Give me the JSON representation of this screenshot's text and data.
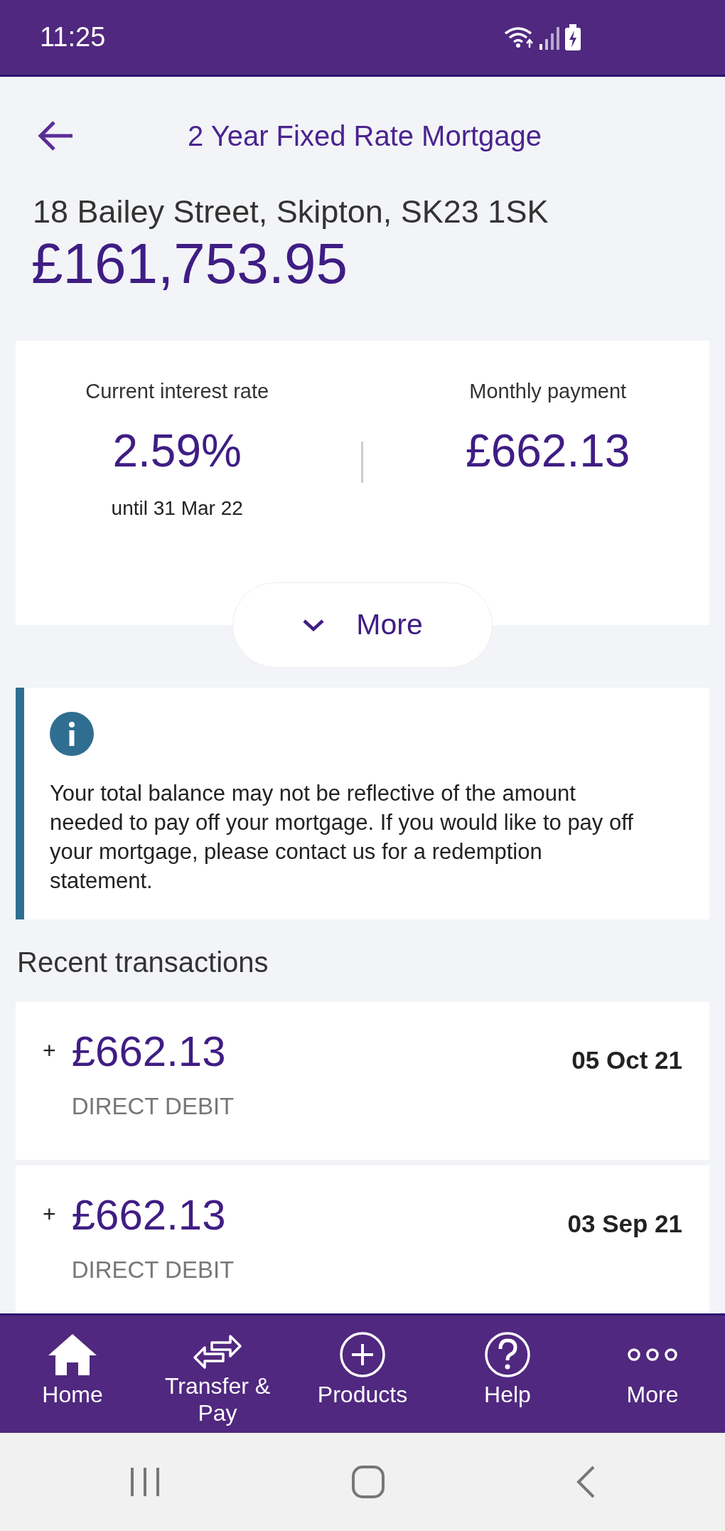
{
  "status_bar": {
    "time": "11:25"
  },
  "header": {
    "title": "2 Year Fixed Rate Mortgage"
  },
  "account": {
    "address": "18 Bailey Street, Skipton, SK23 1SK",
    "balance": "£161,753.95"
  },
  "summary": [
    {
      "label": "Current interest rate",
      "value": "2.59%",
      "note": "until 31 Mar 22"
    },
    {
      "label": "Monthly payment",
      "value": "£662.13"
    }
  ],
  "more_button": {
    "label": "More",
    "expanded": false
  },
  "info": {
    "text": "Your total balance may not be reflective of the amount needed to pay off your mortgage. If you would like to pay off your mortgage, please contact us for a redemption statement."
  },
  "recent_transactions": {
    "title": "Recent transactions",
    "items": [
      {
        "sign": "+",
        "amount": "£662.13",
        "type": "DIRECT DEBIT",
        "date": "05 Oct 21"
      },
      {
        "sign": "+",
        "amount": "£662.13",
        "type": "DIRECT DEBIT",
        "date": "03 Sep 21"
      }
    ]
  },
  "bottom_nav": [
    {
      "kind": "home",
      "label": "Home"
    },
    {
      "kind": "transfer",
      "label": "Transfer & Pay"
    },
    {
      "kind": "products",
      "label": "Products"
    },
    {
      "kind": "help",
      "label": "Help"
    },
    {
      "kind": "more",
      "label": "More"
    }
  ]
}
